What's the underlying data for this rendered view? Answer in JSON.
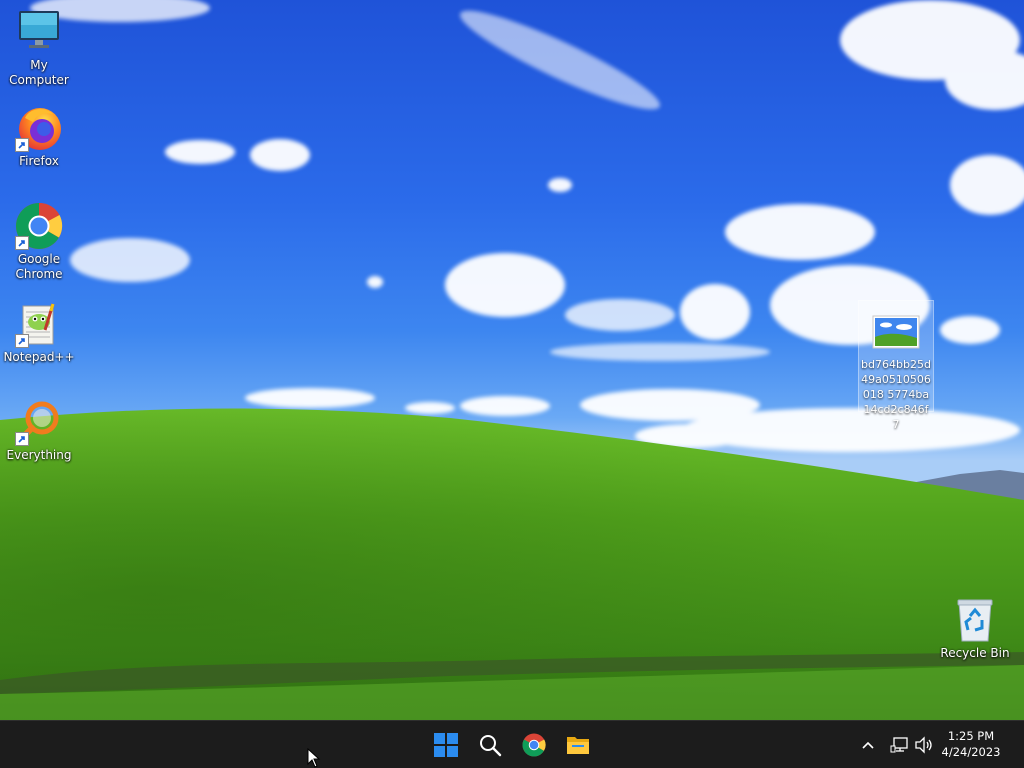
{
  "desktop": {
    "icons": [
      {
        "label": "My Computer",
        "icon": "monitor-icon"
      },
      {
        "label": "Firefox",
        "icon": "firefox-icon"
      },
      {
        "label": "Google Chrome",
        "icon": "chrome-icon"
      },
      {
        "label": "Notepad++",
        "icon": "notepadpp-icon"
      },
      {
        "label": "Everything",
        "icon": "everything-search-icon"
      }
    ],
    "file": {
      "label": "bd764bb25d49a0510506018 5774ba14cd2c846f7",
      "icon": "image-thumbnail-icon"
    },
    "recycle_bin": {
      "label": "Recycle Bin",
      "icon": "recycle-bin-icon"
    }
  },
  "taskbar": {
    "pinned": [
      {
        "name": "Start",
        "icon": "windows-start-icon"
      },
      {
        "name": "Search",
        "icon": "search-icon"
      },
      {
        "name": "Google Chrome",
        "icon": "chrome-icon"
      },
      {
        "name": "File Explorer",
        "icon": "folder-icon"
      }
    ],
    "tray": {
      "time": "1:25 PM",
      "date": "4/24/2023",
      "icons": [
        "chevron-up-icon",
        "network-icon",
        "volume-icon"
      ]
    }
  },
  "colors": {
    "sky": "#2b6bea",
    "grass": "#4f9a1e",
    "taskbar": "#1c1c1c",
    "start_blue": "#2b8cf0"
  }
}
